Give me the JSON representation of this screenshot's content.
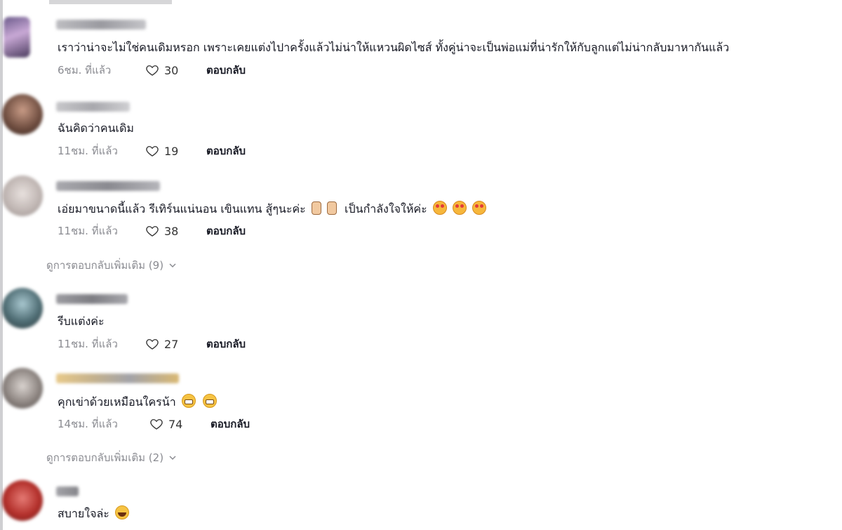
{
  "comments": [
    {
      "text": "เราว่าน่าจะไม่ใช่คนเดิมหรอก เพราะเคยแต่งไปาครั้งแล้วไม่น่าให้แหวนผิดไซส์ ทั้งคู่น่าจะเป็นพ่อแม่ที่น่ารักให้กับลูกแต่ไม่น่ากลับมาหากันแล้ว",
      "time": "6ชม. ที่แล้ว",
      "likes": "30",
      "reply": "ตอบกลับ"
    },
    {
      "text": "ฉันคิดว่าคนเดิม",
      "time": "11ชม. ที่แล้ว",
      "likes": "19",
      "reply": "ตอบกลับ"
    },
    {
      "text": "เอ่ยมาขนาดนี้แล้ว รีเทิร์นแน่นอน เขินแทน สู้ๆนะค่ะ",
      "text_tail": "เป็นกำลังใจให้ค่ะ",
      "emoji": [
        "victory-hand-icon",
        "victory-hand-icon",
        "smiling-heart-eyes-icon",
        "smiling-heart-eyes-icon",
        "smiling-heart-eyes-icon"
      ],
      "time": "11ชม. ที่แล้ว",
      "likes": "38",
      "reply": "ตอบกลับ"
    },
    {
      "text": "รีบแต่งค่ะ",
      "time": "11ชม. ที่แล้ว",
      "likes": "27",
      "reply": "ตอบกลับ"
    },
    {
      "text": "คุกเข่าด้วยเหมือนใครน้า",
      "emoji": [
        "grinning-face-icon",
        "grinning-face-icon"
      ],
      "time": "14ชม. ที่แล้ว",
      "likes": "74",
      "reply": "ตอบกลับ"
    },
    {
      "text": "สบายใจล่ะ",
      "emoji": [
        "laughing-face-icon"
      ]
    }
  ],
  "more_replies": [
    {
      "label": "ดูการตอบกลับเพิ่มเติม (9)"
    },
    {
      "label": "ดูการตอบกลับเพิ่มเติม (2)"
    }
  ],
  "colors": {
    "text": "#161823",
    "muted": "#8a8b91"
  }
}
